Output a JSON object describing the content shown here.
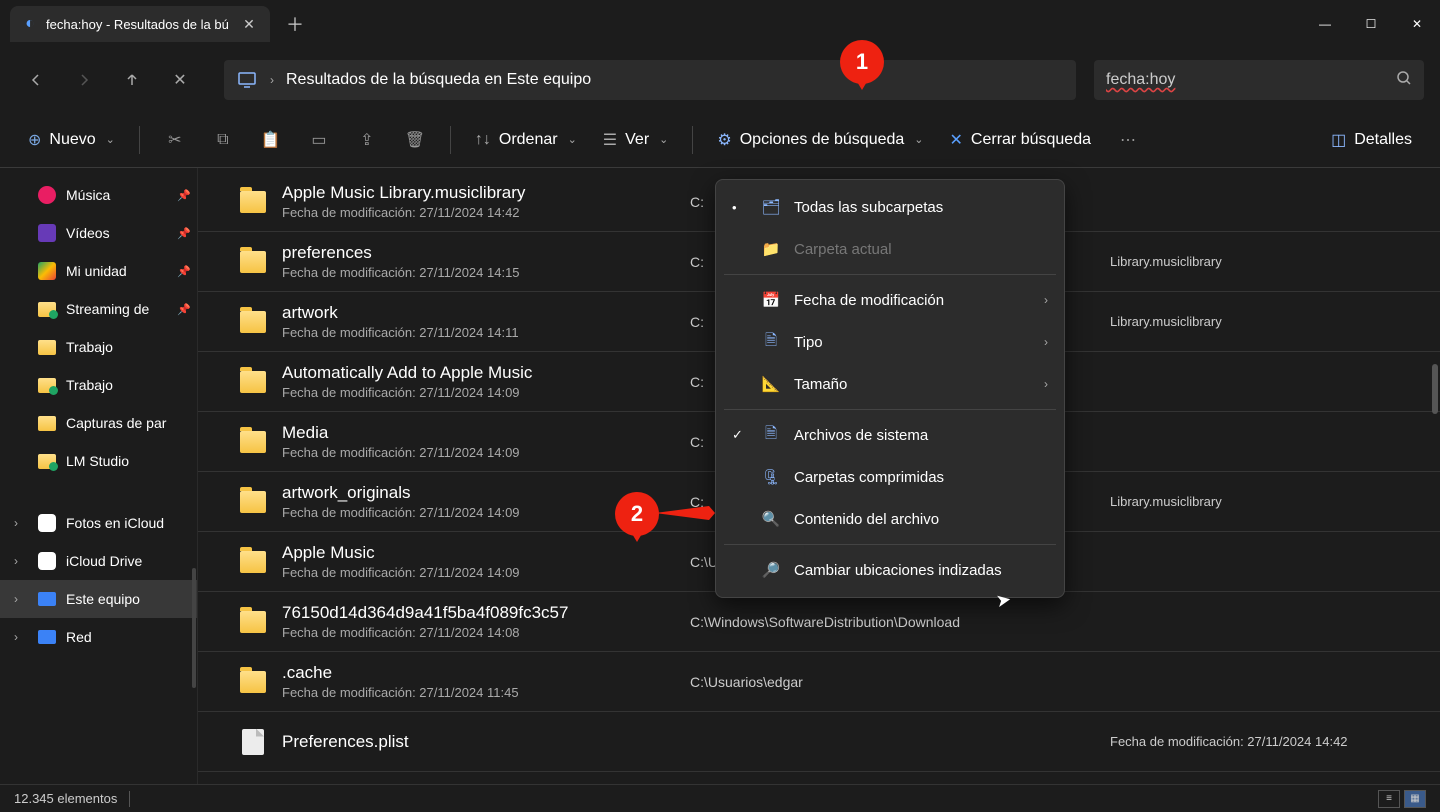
{
  "tab": {
    "title": "fecha:hoy - Resultados de la bú"
  },
  "address": {
    "text": "Resultados de la búsqueda en Este equipo"
  },
  "search": {
    "value": "fecha:hoy"
  },
  "toolbar": {
    "nuevo": "Nuevo",
    "ordenar": "Ordenar",
    "ver": "Ver",
    "opciones": "Opciones de búsqueda",
    "cerrar": "Cerrar búsqueda",
    "detalles": "Detalles"
  },
  "sidebar": {
    "items_top": [
      {
        "label": "Música",
        "icon": "music",
        "pinned": true
      },
      {
        "label": "Vídeos",
        "icon": "video",
        "pinned": true
      },
      {
        "label": "Mi unidad",
        "icon": "drive",
        "pinned": true
      },
      {
        "label": "Streaming de",
        "icon": "folder-g",
        "pinned": true
      },
      {
        "label": "Trabajo",
        "icon": "folder",
        "pinned": false
      },
      {
        "label": "Trabajo",
        "icon": "folder-g",
        "pinned": false
      },
      {
        "label": "Capturas de par",
        "icon": "folder",
        "pinned": false
      },
      {
        "label": "LM Studio",
        "icon": "folder-g",
        "pinned": false
      }
    ],
    "items_bottom": [
      {
        "label": "Fotos en iCloud",
        "icon": "cloud",
        "expand": true
      },
      {
        "label": "iCloud Drive",
        "icon": "cloud",
        "expand": true
      },
      {
        "label": "Este equipo",
        "icon": "pc",
        "expand": true,
        "selected": true
      },
      {
        "label": "Red",
        "icon": "net",
        "expand": true
      }
    ]
  },
  "date_prefix": "Fecha de modificación:",
  "results": [
    {
      "name": "Apple Music Library.musiclibrary",
      "date": "27/11/2024 14:42",
      "path": "C:",
      "type": "folder"
    },
    {
      "name": "preferences",
      "date": "27/11/2024 14:15",
      "path": "C:",
      "meta": "Library.musiclibrary",
      "type": "folder"
    },
    {
      "name": "artwork",
      "date": "27/11/2024 14:11",
      "path": "C:",
      "meta": "Library.musiclibrary",
      "type": "folder-img"
    },
    {
      "name": "Automatically Add to Apple Music",
      "date": "27/11/2024 14:09",
      "path": "C:",
      "type": "folder"
    },
    {
      "name": "Media",
      "date": "27/11/2024 14:09",
      "path": "C:",
      "type": "folder"
    },
    {
      "name": "artwork_originals",
      "date": "27/11/2024 14:09",
      "path": "C:",
      "meta": "Library.musiclibrary",
      "type": "folder"
    },
    {
      "name": "Apple Music",
      "date": "27/11/2024 14:09",
      "path": "C:\\Usuarios\\edgar\\Música",
      "type": "folder"
    },
    {
      "name": "76150d14d364d9a41f5ba4f089fc3c57",
      "date": "27/11/2024 14:08",
      "path": "C:\\Windows\\SoftwareDistribution\\Download",
      "type": "folder"
    },
    {
      "name": ".cache",
      "date": "27/11/2024 11:45",
      "path": "C:\\Usuarios\\edgar",
      "type": "folder"
    },
    {
      "name": "Preferences.plist",
      "date": "",
      "path": "",
      "meta": "Fecha de modificación: 27/11/2024 14:42",
      "type": "file"
    }
  ],
  "dropdown": {
    "todas": "Todas las subcarpetas",
    "actual": "Carpeta actual",
    "fecha": "Fecha de modificación",
    "tipo": "Tipo",
    "tamano": "Tamaño",
    "sistema": "Archivos de sistema",
    "comprimidas": "Carpetas comprimidas",
    "contenido": "Contenido del archivo",
    "cambiar": "Cambiar ubicaciones indizadas"
  },
  "status": {
    "count": "12.345 elementos"
  },
  "markers": {
    "m1": "1",
    "m2": "2"
  }
}
